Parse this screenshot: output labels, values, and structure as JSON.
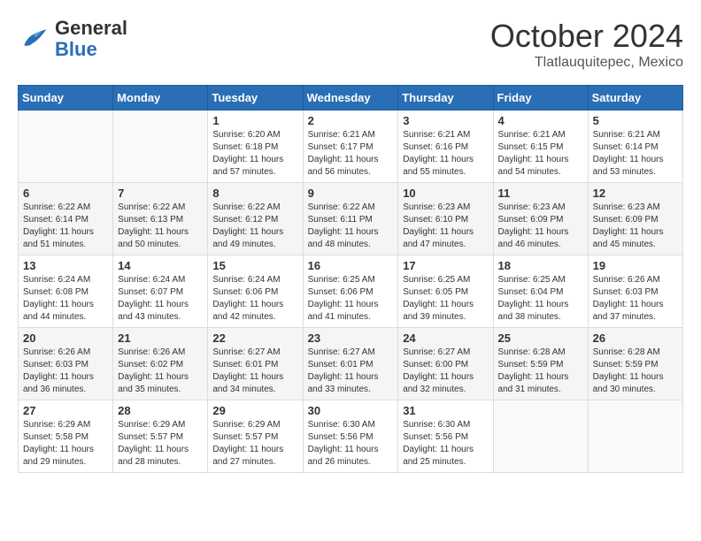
{
  "header": {
    "logo_general": "General",
    "logo_blue": "Blue",
    "month_year": "October 2024",
    "location": "Tlatlauquitepec, Mexico"
  },
  "weekdays": [
    "Sunday",
    "Monday",
    "Tuesday",
    "Wednesday",
    "Thursday",
    "Friday",
    "Saturday"
  ],
  "weeks": [
    [
      {
        "day": "",
        "info": ""
      },
      {
        "day": "",
        "info": ""
      },
      {
        "day": "1",
        "info": "Sunrise: 6:20 AM\nSunset: 6:18 PM\nDaylight: 11 hours and 57 minutes."
      },
      {
        "day": "2",
        "info": "Sunrise: 6:21 AM\nSunset: 6:17 PM\nDaylight: 11 hours and 56 minutes."
      },
      {
        "day": "3",
        "info": "Sunrise: 6:21 AM\nSunset: 6:16 PM\nDaylight: 11 hours and 55 minutes."
      },
      {
        "day": "4",
        "info": "Sunrise: 6:21 AM\nSunset: 6:15 PM\nDaylight: 11 hours and 54 minutes."
      },
      {
        "day": "5",
        "info": "Sunrise: 6:21 AM\nSunset: 6:14 PM\nDaylight: 11 hours and 53 minutes."
      }
    ],
    [
      {
        "day": "6",
        "info": "Sunrise: 6:22 AM\nSunset: 6:14 PM\nDaylight: 11 hours and 51 minutes."
      },
      {
        "day": "7",
        "info": "Sunrise: 6:22 AM\nSunset: 6:13 PM\nDaylight: 11 hours and 50 minutes."
      },
      {
        "day": "8",
        "info": "Sunrise: 6:22 AM\nSunset: 6:12 PM\nDaylight: 11 hours and 49 minutes."
      },
      {
        "day": "9",
        "info": "Sunrise: 6:22 AM\nSunset: 6:11 PM\nDaylight: 11 hours and 48 minutes."
      },
      {
        "day": "10",
        "info": "Sunrise: 6:23 AM\nSunset: 6:10 PM\nDaylight: 11 hours and 47 minutes."
      },
      {
        "day": "11",
        "info": "Sunrise: 6:23 AM\nSunset: 6:09 PM\nDaylight: 11 hours and 46 minutes."
      },
      {
        "day": "12",
        "info": "Sunrise: 6:23 AM\nSunset: 6:09 PM\nDaylight: 11 hours and 45 minutes."
      }
    ],
    [
      {
        "day": "13",
        "info": "Sunrise: 6:24 AM\nSunset: 6:08 PM\nDaylight: 11 hours and 44 minutes."
      },
      {
        "day": "14",
        "info": "Sunrise: 6:24 AM\nSunset: 6:07 PM\nDaylight: 11 hours and 43 minutes."
      },
      {
        "day": "15",
        "info": "Sunrise: 6:24 AM\nSunset: 6:06 PM\nDaylight: 11 hours and 42 minutes."
      },
      {
        "day": "16",
        "info": "Sunrise: 6:25 AM\nSunset: 6:06 PM\nDaylight: 11 hours and 41 minutes."
      },
      {
        "day": "17",
        "info": "Sunrise: 6:25 AM\nSunset: 6:05 PM\nDaylight: 11 hours and 39 minutes."
      },
      {
        "day": "18",
        "info": "Sunrise: 6:25 AM\nSunset: 6:04 PM\nDaylight: 11 hours and 38 minutes."
      },
      {
        "day": "19",
        "info": "Sunrise: 6:26 AM\nSunset: 6:03 PM\nDaylight: 11 hours and 37 minutes."
      }
    ],
    [
      {
        "day": "20",
        "info": "Sunrise: 6:26 AM\nSunset: 6:03 PM\nDaylight: 11 hours and 36 minutes."
      },
      {
        "day": "21",
        "info": "Sunrise: 6:26 AM\nSunset: 6:02 PM\nDaylight: 11 hours and 35 minutes."
      },
      {
        "day": "22",
        "info": "Sunrise: 6:27 AM\nSunset: 6:01 PM\nDaylight: 11 hours and 34 minutes."
      },
      {
        "day": "23",
        "info": "Sunrise: 6:27 AM\nSunset: 6:01 PM\nDaylight: 11 hours and 33 minutes."
      },
      {
        "day": "24",
        "info": "Sunrise: 6:27 AM\nSunset: 6:00 PM\nDaylight: 11 hours and 32 minutes."
      },
      {
        "day": "25",
        "info": "Sunrise: 6:28 AM\nSunset: 5:59 PM\nDaylight: 11 hours and 31 minutes."
      },
      {
        "day": "26",
        "info": "Sunrise: 6:28 AM\nSunset: 5:59 PM\nDaylight: 11 hours and 30 minutes."
      }
    ],
    [
      {
        "day": "27",
        "info": "Sunrise: 6:29 AM\nSunset: 5:58 PM\nDaylight: 11 hours and 29 minutes."
      },
      {
        "day": "28",
        "info": "Sunrise: 6:29 AM\nSunset: 5:57 PM\nDaylight: 11 hours and 28 minutes."
      },
      {
        "day": "29",
        "info": "Sunrise: 6:29 AM\nSunset: 5:57 PM\nDaylight: 11 hours and 27 minutes."
      },
      {
        "day": "30",
        "info": "Sunrise: 6:30 AM\nSunset: 5:56 PM\nDaylight: 11 hours and 26 minutes."
      },
      {
        "day": "31",
        "info": "Sunrise: 6:30 AM\nSunset: 5:56 PM\nDaylight: 11 hours and 25 minutes."
      },
      {
        "day": "",
        "info": ""
      },
      {
        "day": "",
        "info": ""
      }
    ]
  ]
}
